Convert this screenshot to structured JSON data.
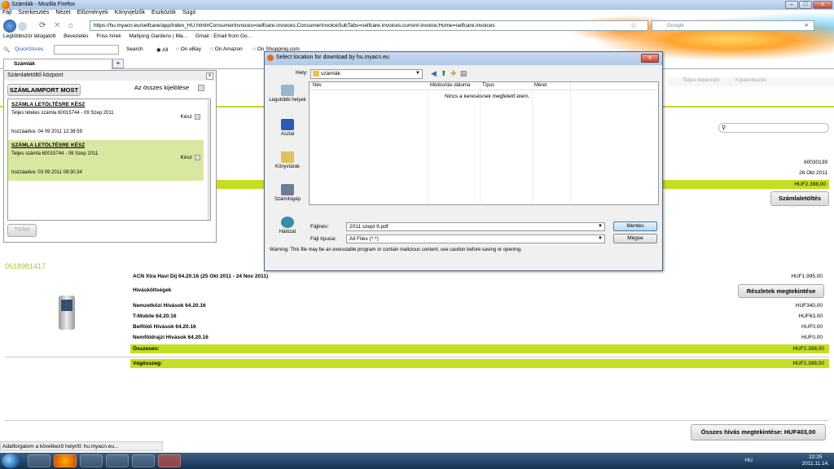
{
  "window": {
    "title": "Számlák - Mozilla Firefox",
    "menu": [
      "Fájl",
      "Szerkesztés",
      "Nézet",
      "Előzmények",
      "Könyvjelzők",
      "Eszközök",
      "Súgó"
    ],
    "url": "https://hu.myacn.eu/selfcare/app/index_HU.html#ConsumerInvoices=selfcare.invoices;ConsumerInvoiceSubTabs=selfcare.invoices.current-invoice;Home=selfcare.invoices",
    "search_placeholder": "Google"
  },
  "bookmarks": [
    "Legtöbbször látogatott",
    "Bevezetés",
    "Friss hírek",
    "Mahjong Gardens | Ma...",
    "Gmail : Email from Go..."
  ],
  "quickstores": {
    "label": "QuickStores",
    "search": "Search",
    "opts": [
      "All",
      "On eBay",
      "On Amazon",
      "On Shopping.com"
    ]
  },
  "tab": {
    "label": "Számlák",
    "plus": "+"
  },
  "page": {
    "menu": [
      "Teljes képernyő",
      "Kijelentkezés"
    ],
    "account_number": "60030139",
    "date": "26 Okt 2011",
    "amount_bar": "HUF2.398,00",
    "download_button": "Számlaletöltés",
    "phone_number": "0618981417",
    "plan": "ACN Xtra Havi Díj  64.20.16 (25 Okt 2011 - 24 Nov 2011)",
    "plan_value": "HUF1.995,00",
    "call_costs": "Hívásköltségek",
    "details_button": "Részletek megtekintése",
    "rows": [
      {
        "label": "Nemzetközi Hívások 64.20.16",
        "value": "HUF340,00"
      },
      {
        "label": "T-Mobile 64.20.16",
        "value": "HUF63,00"
      },
      {
        "label": "Belföldi Hívások 64.20.16",
        "value": "HUF0,00"
      },
      {
        "label": "Nemföldrajzi Hívások 64.20.16",
        "value": "HUF0,00"
      }
    ],
    "total_label": "Összesen:",
    "total_value": "HUF2.398,00",
    "grand_label": "Végösszeg:",
    "grand_value": "HUF2.398,00",
    "all_calls_button": "Összes hívás megtekintése: HUF403,00"
  },
  "download_panel": {
    "title": "Számlaletöltő központ",
    "close": "x",
    "import_button": "SZÁMLAIMPORT MOST",
    "select_all": "Az összes kijelölése",
    "items": [
      {
        "title": "SZÁMLA LETÖLTÉSRE KÉSZ",
        "desc": "Teljes tételes számla 60015744 - 09 Szep 2011",
        "status": "Kész",
        "added": "hozzáadva: 04 09 2011 12:38:59"
      },
      {
        "title": "SZÁMLA LETÖLTÉSRE KÉSZ",
        "desc": "Teljes számla 60015744 - 09 Szep 2011",
        "status": "Kész",
        "added": "hozzáadva: 03 09 2011 09:30:34"
      }
    ],
    "delete_button": "Törlés"
  },
  "dialog": {
    "title": "Select location for download by hu.myacn.eu",
    "close": "x",
    "look_in_label": "Hely:",
    "look_in_value": "számlák",
    "places": [
      "Legutóbbi helyek",
      "Asztal",
      "Könyvtárak",
      "Számítógép",
      "Hálózat"
    ],
    "columns": [
      "Név",
      "Módosítás dátuma",
      "Típus",
      "Méret"
    ],
    "empty_message": "Nincs a keresésnek megfelelő elem.",
    "filename_label": "Fájlnév:",
    "filename_value": "2011 szept 9.pdf",
    "filetype_label": "Fájl típusa:",
    "filetype_value": "All Files (*.*)",
    "save_button": "Mentés",
    "cancel_button": "Mégse",
    "warning": "Warning: This file may be an executable program or contain malicious content, use caution before saving or opening."
  },
  "status_bar": "Adatforgalom a következő helyről: hu.myacn.eu...",
  "taskbar": {
    "lang": "HU",
    "time": "22:25",
    "date": "2011.11.14."
  }
}
